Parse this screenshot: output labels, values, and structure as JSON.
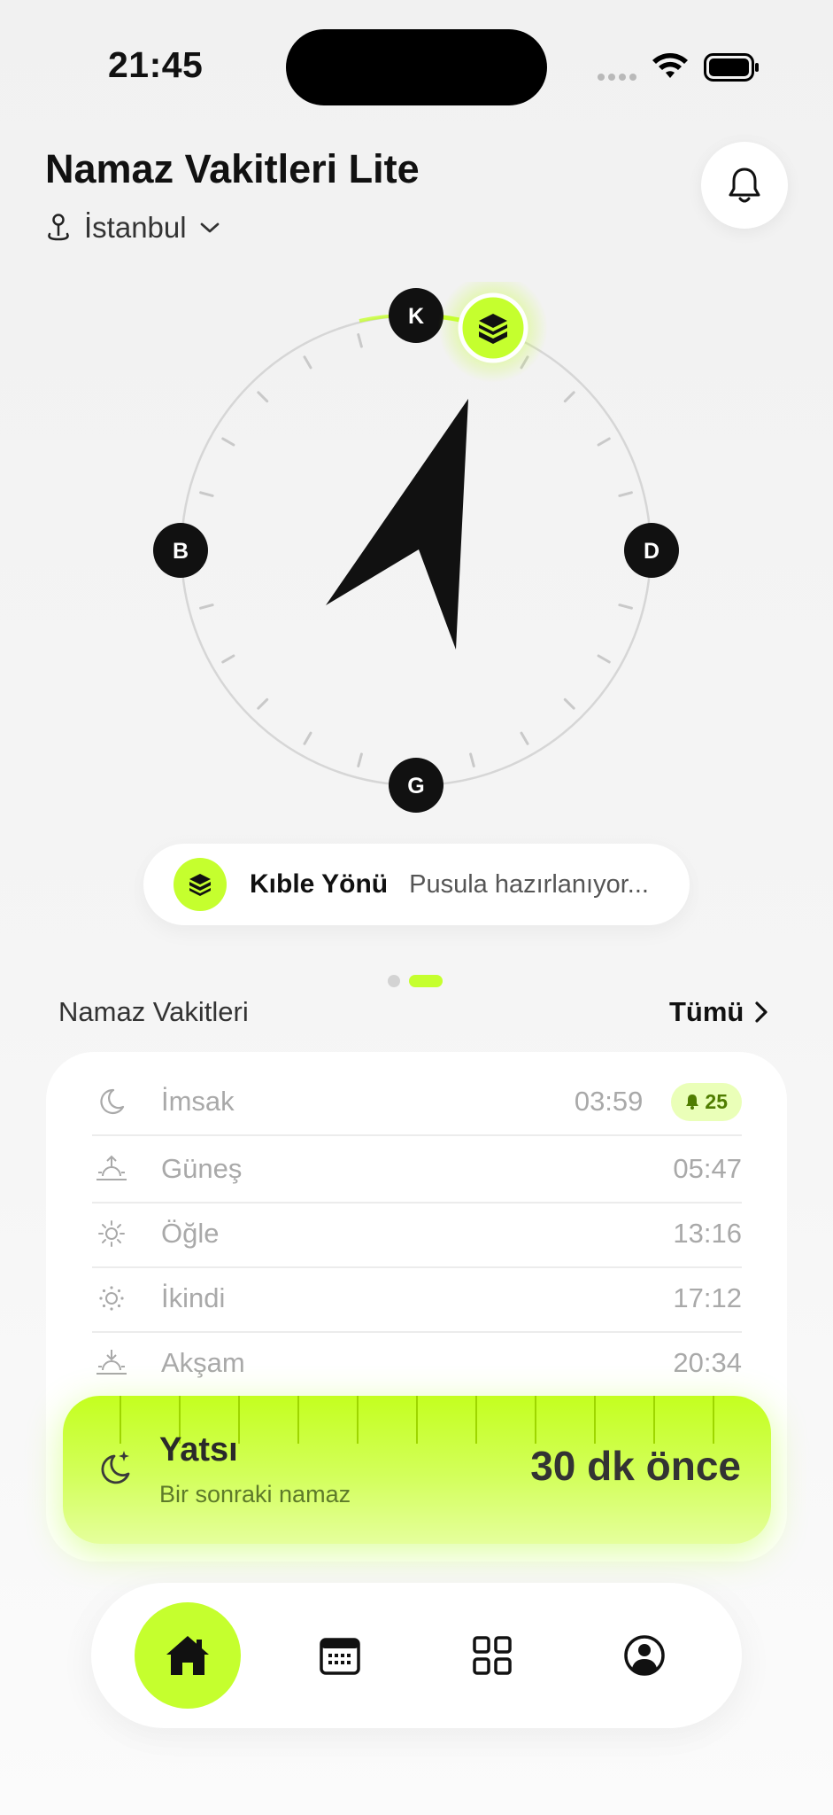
{
  "status_bar": {
    "time": "21:45"
  },
  "header": {
    "title": "Namaz Vakitleri Lite",
    "location": "İstanbul",
    "icons": {
      "location": "location-pin-icon",
      "chevron": "chevron-down-icon",
      "bell": "bell-icon"
    }
  },
  "compass": {
    "directions": {
      "north": "K",
      "south": "G",
      "east": "D",
      "west": "B"
    },
    "qibla_icon": "kaaba-icon",
    "needle_color": "#111111",
    "accent": "#c5ff2e"
  },
  "qibla": {
    "label": "Kıble Yönü",
    "status": "Pusula hazırlanıyor..."
  },
  "prayer_times": {
    "title": "Namaz Vakitleri",
    "see_all": "Tümü",
    "rows": [
      {
        "name": "İmsak",
        "time": "03:59",
        "icon": "moon-icon",
        "badge": "25"
      },
      {
        "name": "Güneş",
        "time": "05:47",
        "icon": "sunrise-icon"
      },
      {
        "name": "Öğle",
        "time": "13:16",
        "icon": "sun-icon"
      },
      {
        "name": "İkindi",
        "time": "17:12",
        "icon": "sun-small-icon"
      },
      {
        "name": "Akşam",
        "time": "20:34",
        "icon": "sunset-icon"
      }
    ]
  },
  "next_prayer": {
    "name": "Yatsı",
    "subtitle": "Bir sonraki namaz",
    "countdown": "30 dk önce",
    "icon": "moon-stars-icon"
  },
  "tabbar": {
    "items": [
      {
        "icon": "home-icon",
        "active": true
      },
      {
        "icon": "calendar-icon",
        "active": false
      },
      {
        "icon": "grid-icon",
        "active": false
      },
      {
        "icon": "profile-icon",
        "active": false
      }
    ]
  }
}
